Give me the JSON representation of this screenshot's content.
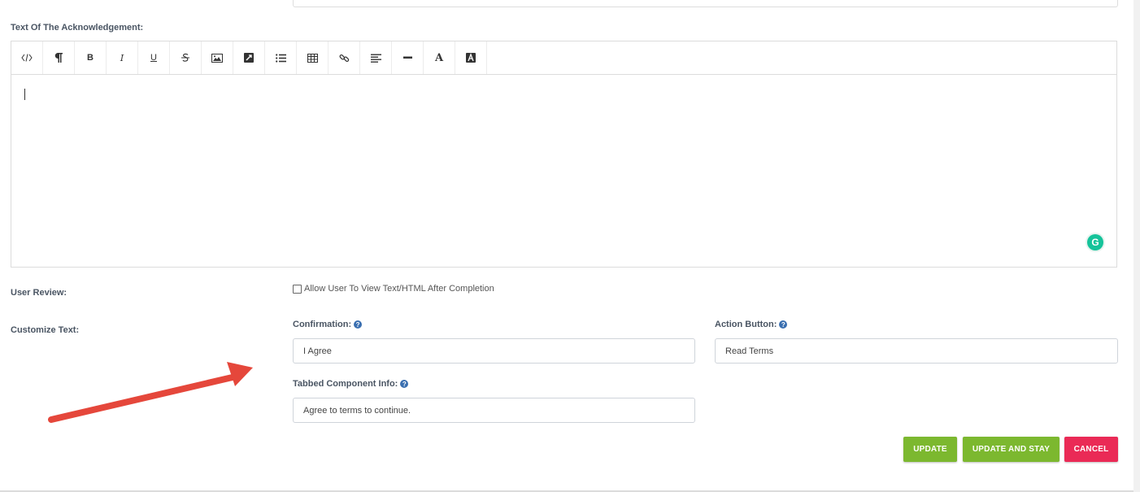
{
  "form": {
    "ack_label": "Text Of The Acknowledgement:",
    "user_review_label": "User Review:",
    "customize_text_label": "Customize Text:",
    "allow_view_label": "Allow User To View Text/HTML After Completion",
    "confirmation_label": "Confirmation:",
    "confirmation_value": "I Agree",
    "action_button_label": "Action Button:",
    "action_button_value": "Read Terms",
    "tabbed_info_label": "Tabbed Component Info:",
    "tabbed_info_value": "Agree to terms to continue.",
    "help_glyph": "?"
  },
  "toolbar": {
    "bold": "B",
    "italic": "I",
    "underline": "U",
    "font_glyph": "A",
    "icons": [
      "code-view-icon",
      "paragraph-icon",
      "bold-icon",
      "italic-icon",
      "underline-icon",
      "strikethrough-icon",
      "image-icon",
      "video-icon",
      "list-icon",
      "table-icon",
      "link-icon",
      "align-left-icon",
      "horizontal-rule-icon",
      "font-icon",
      "font-color-icon"
    ]
  },
  "buttons": {
    "update": "UPDATE",
    "update_and_stay": "UPDATE AND STAY",
    "cancel": "CANCEL"
  },
  "colors": {
    "green": "#7cb82f",
    "red": "#ea2a56",
    "help": "#3a6fb0",
    "arrow": "#e5473b"
  },
  "grammarly": {
    "glyph": "G"
  }
}
